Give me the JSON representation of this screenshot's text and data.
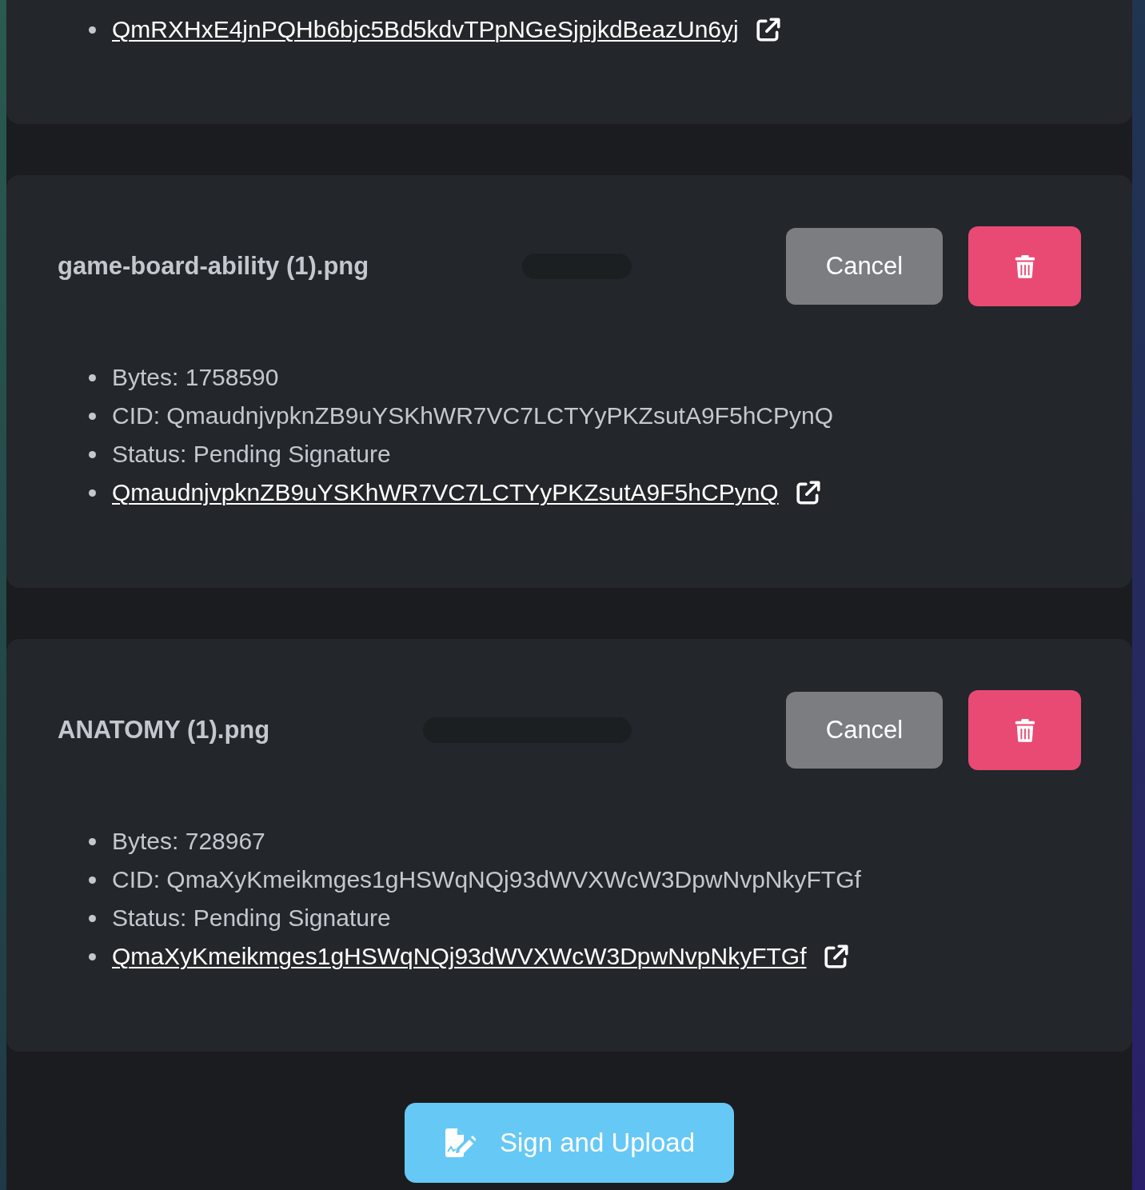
{
  "files": [
    {
      "details": [
        {
          "kind": "link",
          "text": "QmRXHxE4jnPQHb6bjc5Bd5kdvTPpNGeSjpjkdBeazUn6yj"
        }
      ]
    },
    {
      "name": "game-board-ability (1).png",
      "progress": {
        "level": 0
      },
      "cancel": "Cancel",
      "details": [
        {
          "kind": "text",
          "text": "Bytes: 1758590"
        },
        {
          "kind": "text",
          "text": "CID: QmaudnjvpknZB9uYSKhWR7VC7LCTYyPKZsutA9F5hCPynQ"
        },
        {
          "kind": "text",
          "text": "Status: Pending Signature"
        },
        {
          "kind": "link",
          "text": "QmaudnjvpknZB9uYSKhWR7VC7LCTYyPKZsutA9F5hCPynQ"
        }
      ]
    },
    {
      "name": "ANATOMY (1).png",
      "progress": {
        "level": 0
      },
      "cancel": "Cancel",
      "details": [
        {
          "kind": "text",
          "text": "Bytes: 728967"
        },
        {
          "kind": "text",
          "text": "CID: QmaXyKmeikmges1gHSWqNQj93dWVXWcW3DpwNvpNkyFTGf"
        },
        {
          "kind": "text",
          "text": "Status: Pending Signature"
        },
        {
          "kind": "link",
          "text": "QmaXyKmeikmges1gHSWqNQj93dWVXWcW3DpwNvpNkyFTGf"
        }
      ]
    }
  ],
  "submit": {
    "label": "Sign and Upload"
  }
}
